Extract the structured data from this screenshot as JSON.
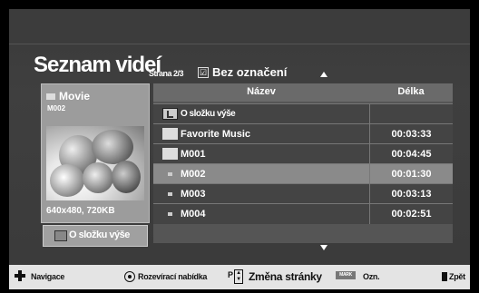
{
  "title": "Seznam videí",
  "page_info": "Strana 2/3",
  "checkbox_glyph": "☑",
  "filter_label": "Bez označení",
  "preview": {
    "folder_icon": "folder-icon",
    "folder_name": "Movie",
    "sub": "M002",
    "resolution": "640x480, 720KB"
  },
  "up_button": "O složku výše",
  "columns": {
    "name": "Název",
    "duration": "Délka"
  },
  "rows": [
    {
      "icon": "folder-up-icon",
      "name": "O složku výše",
      "duration": ""
    },
    {
      "icon": "folder-icon",
      "name": "Favorite Music",
      "duration": "00:03:33"
    },
    {
      "icon": "folder-icon",
      "name": "M001",
      "duration": "00:04:45"
    },
    {
      "icon": "video-file-icon",
      "name": "M002",
      "duration": "00:01:30",
      "selected": true
    },
    {
      "icon": "video-file-icon",
      "name": "M003",
      "duration": "00:03:13"
    },
    {
      "icon": "video-file-icon",
      "name": "M004",
      "duration": "00:02:51"
    }
  ],
  "footer": {
    "nav": "Navigace",
    "popup": "Rozevírací nabídka",
    "page_change": "Změna stránky",
    "mark_key": "MARK",
    "mark": "Ozn.",
    "back": "Zpět"
  }
}
